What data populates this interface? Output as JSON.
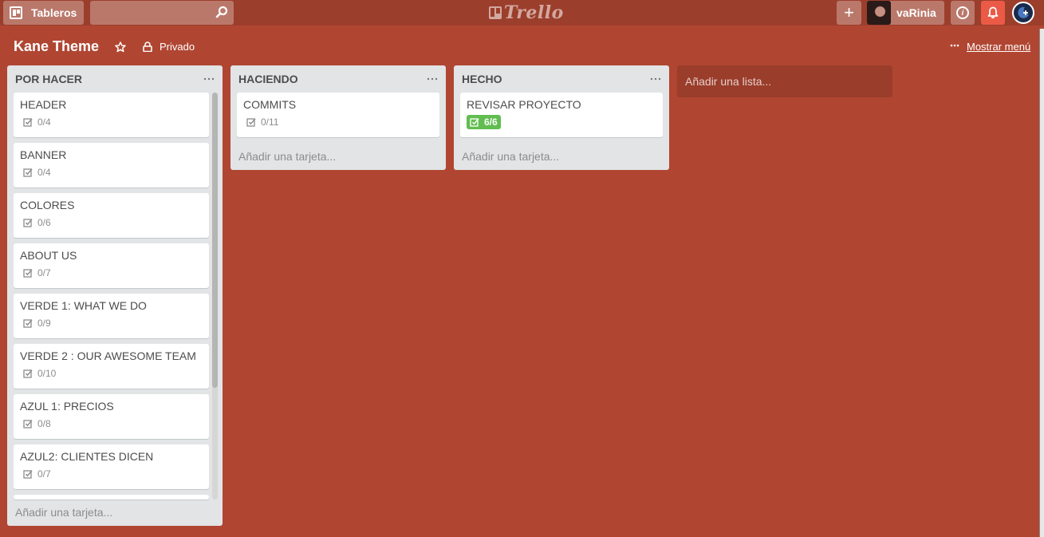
{
  "header": {
    "boards_label": "Tableros",
    "search_placeholder": "",
    "logo_text": "Trello",
    "username": "vaRinia",
    "add_symbol": "+"
  },
  "board": {
    "title": "Kane Theme",
    "privacy": "Privado",
    "show_menu": "Mostrar menú"
  },
  "lists": [
    {
      "name": "POR HACER",
      "cards": [
        {
          "title": "HEADER",
          "checklist": "0/4"
        },
        {
          "title": "BANNER",
          "checklist": "0/4"
        },
        {
          "title": "COLORES",
          "checklist": "0/6"
        },
        {
          "title": "ABOUT US",
          "checklist": "0/7"
        },
        {
          "title": "VERDE 1: WHAT WE DO",
          "checklist": "0/9"
        },
        {
          "title": "VERDE 2 : OUR AWESOME TEAM",
          "checklist": "0/10"
        },
        {
          "title": "AZUL 1: PRECIOS",
          "checklist": "0/8"
        },
        {
          "title": "AZUL2: CLIENTES DICEN",
          "checklist": "0/7"
        }
      ],
      "add_card": "Añadir una tarjeta..."
    },
    {
      "name": "HACIENDO",
      "cards": [
        {
          "title": "COMMITS",
          "checklist": "0/11"
        }
      ],
      "add_card": "Añadir una tarjeta..."
    },
    {
      "name": "HECHO",
      "cards": [
        {
          "title": "REVISAR PROYECTO",
          "checklist": "6/6",
          "complete": true
        }
      ],
      "add_card": "Añadir una tarjeta..."
    }
  ],
  "add_list": "Añadir una lista...",
  "colors": {
    "board_bg": "#b04632",
    "header_bg": "#9c3e2c",
    "complete_badge": "#61bd4f",
    "notification": "#eb5a46"
  }
}
